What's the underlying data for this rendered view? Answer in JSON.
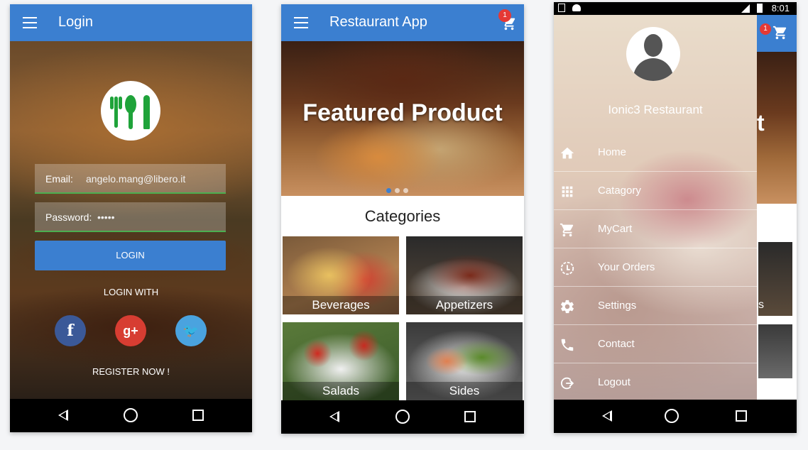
{
  "login_screen": {
    "title": "Login",
    "email_label": "Email:",
    "email_value": "angelo.mang@libero.it",
    "password_label": "Password:",
    "password_value": "•••••",
    "login_button": "LOGIN",
    "login_with": "LOGIN WITH",
    "social": [
      {
        "name": "facebook-icon",
        "glyph": "f",
        "color": "#3b5998"
      },
      {
        "name": "google-plus-icon",
        "glyph": "g+",
        "color": "#d73d32"
      },
      {
        "name": "twitter-icon",
        "glyph": "🐦",
        "color": "#4aa3df"
      }
    ],
    "register": "REGISTER NOW !"
  },
  "home_screen": {
    "title": "Restaurant App",
    "cart_badge": "1",
    "featured": "Featured Product",
    "categories_title": "Categories",
    "categories": [
      {
        "label": "Beverages"
      },
      {
        "label": "Appetizers"
      },
      {
        "label": "Salads"
      },
      {
        "label": "Sides"
      }
    ]
  },
  "drawer_screen": {
    "status_time": "8:01",
    "cart_badge": "1",
    "restaurant_name": "Ionic3 Restaurant",
    "peek_title_fragment": "t",
    "peek_tile_fragment": "s",
    "menu": [
      {
        "label": "Home",
        "icon": "home-icon"
      },
      {
        "label": "Catagory",
        "icon": "grid-icon"
      },
      {
        "label": "MyCart",
        "icon": "cart-icon"
      },
      {
        "label": "Your Orders",
        "icon": "orders-icon"
      },
      {
        "label": "Settings",
        "icon": "gear-icon"
      },
      {
        "label": "Contact",
        "icon": "phone-icon"
      },
      {
        "label": "Logout",
        "icon": "logout-icon"
      }
    ]
  },
  "colors": {
    "primary": "#3b7fd0",
    "logo_green": "#1fa33a",
    "badge_red": "#e53935"
  }
}
